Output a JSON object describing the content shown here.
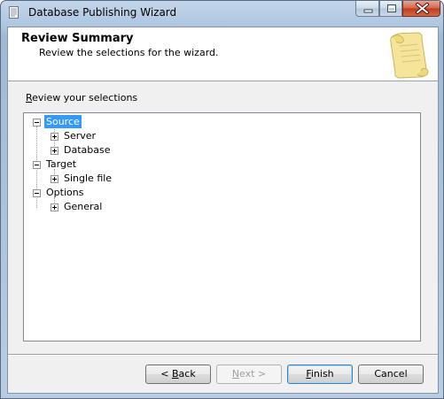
{
  "window": {
    "title": "Database Publishing Wizard"
  },
  "header": {
    "title": "Review Summary",
    "subtitle": "Review the selections for the wizard."
  },
  "section_label": "Review your selections",
  "tree": {
    "nodes": [
      {
        "label": "Source",
        "level": 0,
        "expanded": true,
        "selected": true
      },
      {
        "label": "Server",
        "level": 1,
        "expanded": false,
        "selected": false
      },
      {
        "label": "Database",
        "level": 1,
        "expanded": false,
        "selected": false
      },
      {
        "label": "Target",
        "level": 0,
        "expanded": true,
        "selected": false
      },
      {
        "label": "Single file",
        "level": 1,
        "expanded": false,
        "selected": false
      },
      {
        "label": "Options",
        "level": 0,
        "expanded": true,
        "selected": false
      },
      {
        "label": "General",
        "level": 1,
        "expanded": false,
        "selected": false
      }
    ]
  },
  "buttons": {
    "back": {
      "mnemonic": "B",
      "rest": "ack",
      "prefix": "< ",
      "enabled": true
    },
    "next": {
      "mnemonic": "N",
      "rest": "ext >",
      "prefix": "",
      "enabled": false
    },
    "finish": {
      "mnemonic": "F",
      "rest": "inish",
      "prefix": "",
      "enabled": true
    },
    "cancel": {
      "label": "Cancel",
      "enabled": true
    }
  },
  "icons": {
    "app": "document-icon",
    "minimize": "minimize-icon",
    "maximize": "maximize-icon",
    "close": "close-icon",
    "header_graphic": "scroll-icon",
    "tree_collapse": "minus-box-icon",
    "tree_expand": "plus-box-icon"
  },
  "colors": {
    "selection": "#3399ff",
    "close_button": "#c0391b"
  }
}
